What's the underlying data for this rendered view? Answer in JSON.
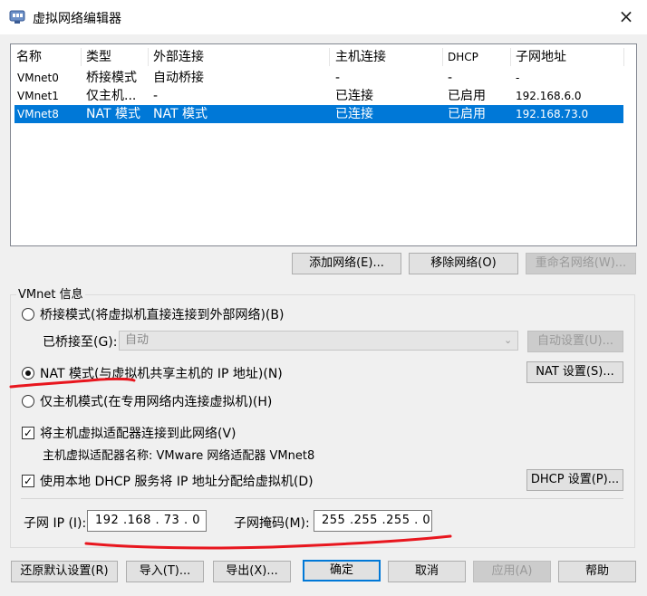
{
  "window": {
    "title": "虚拟网络编辑器",
    "close_icon": "×"
  },
  "table": {
    "headers": [
      "名称",
      "类型",
      "外部连接",
      "主机连接",
      "DHCP",
      "子网地址"
    ],
    "rows": [
      [
        "VMnet0",
        "桥接模式",
        "自动桥接",
        "-",
        "-",
        "-"
      ],
      [
        "VMnet1",
        "仅主机...",
        "-",
        "已连接",
        "已启用",
        "192.168.6.0"
      ],
      [
        "VMnet8",
        "NAT 模式",
        "NAT 模式",
        "已连接",
        "已启用",
        "192.168.73.0"
      ]
    ],
    "selected_row": "VMnet8"
  },
  "network_buttons": {
    "add": "添加网络(E)...",
    "remove": "移除网络(O)",
    "rename": "重命名网络(W)..."
  },
  "vmnet_info": {
    "group_label": "VMnet 信息",
    "bridged_radio": "桥接模式(将虚拟机直接连接到外部网络)(B)",
    "bridged_to_label": "已桥接至(G):",
    "bridged_to_value": "自动",
    "auto_settings_button": "自动设置(U)...",
    "nat_radio": "NAT 模式(与虚拟机共享主机的 IP 地址)(N)",
    "nat_settings_button": "NAT 设置(S)...",
    "host_only_radio": "仅主机模式(在专用网络内连接虚拟机)(H)",
    "selected_mode": "NAT",
    "connect_adapter_checkbox": "将主机虚拟适配器连接到此网络(V)",
    "adapter_name_text": "主机虚拟适配器名称: VMware 网络适配器 VMnet8",
    "use_dhcp_checkbox": "使用本地 DHCP 服务将 IP 地址分配给虚拟机(D)",
    "dhcp_settings_button": "DHCP 设置(P)...",
    "subnet_ip_label": "子网 IP (I):",
    "subnet_ip_value": "192 .168 . 73 . 0",
    "subnet_mask_label": "子网掩码(M):",
    "subnet_mask_value": "255 .255 .255 . 0"
  },
  "footer_buttons": {
    "restore_defaults": "还原默认设置(R)",
    "import": "导入(T)...",
    "export": "导出(X)...",
    "ok": "确定",
    "cancel": "取消",
    "apply": "应用(A)",
    "help": "帮助"
  },
  "colors": {
    "selection": "#0078d7",
    "annotation": "#e8161e",
    "window_bg": "#f0f0f0"
  }
}
